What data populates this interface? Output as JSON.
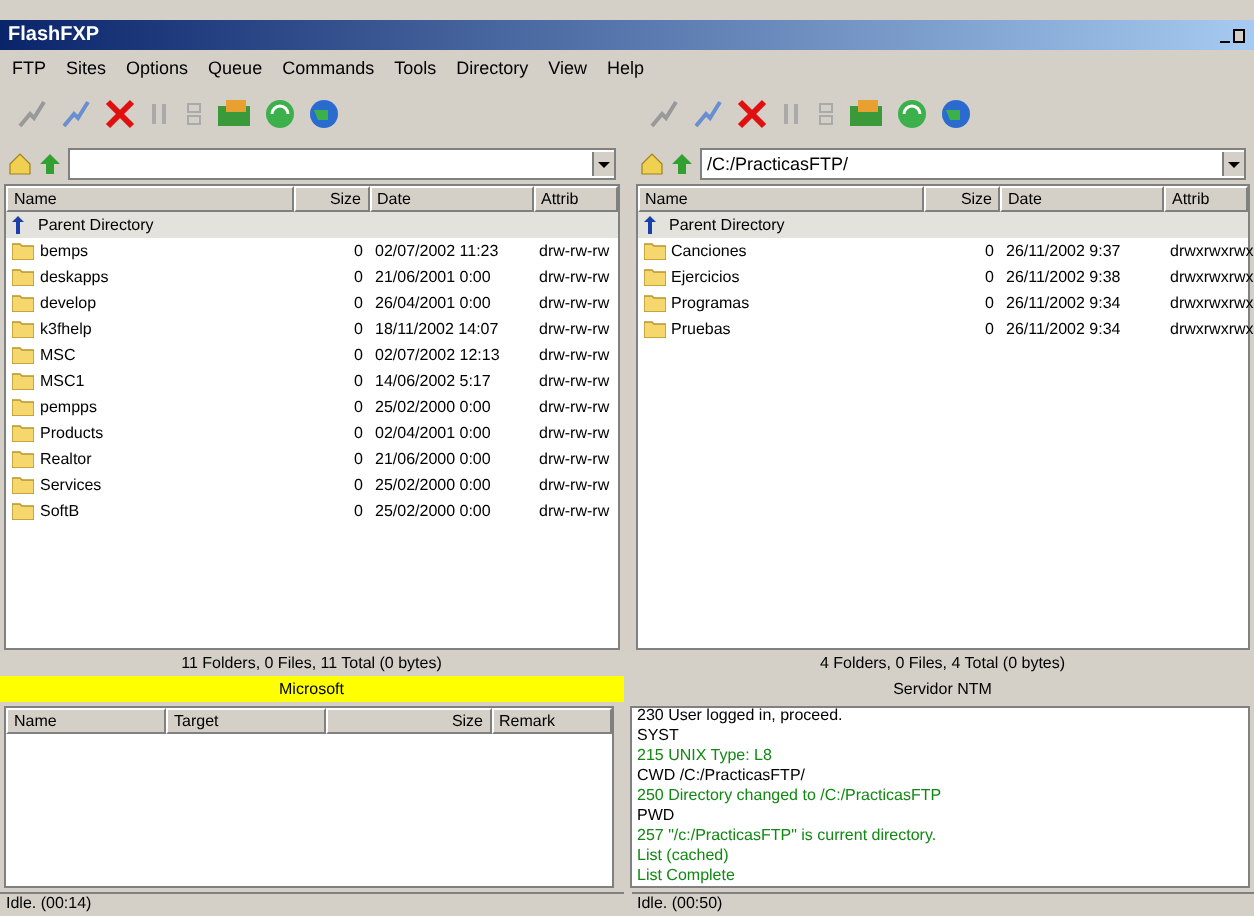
{
  "window": {
    "title": "FlashFXP"
  },
  "menu": [
    "FTP",
    "Sites",
    "Options",
    "Queue",
    "Commands",
    "Tools",
    "Directory",
    "View",
    "Help"
  ],
  "panes": [
    {
      "columns": [
        "Name",
        "Size",
        "Date",
        "Attrib"
      ],
      "parent": "Parent Directory",
      "rows": [
        {
          "name": "bemps",
          "size": "0",
          "date": "02/07/2002 11:23",
          "attrib": "drw-rw-rw"
        },
        {
          "name": "deskapps",
          "size": "0",
          "date": "21/06/2001 0:00",
          "attrib": "drw-rw-rw"
        },
        {
          "name": "develop",
          "size": "0",
          "date": "26/04/2001 0:00",
          "attrib": "drw-rw-rw"
        },
        {
          "name": "k3fhelp",
          "size": "0",
          "date": "18/11/2002 14:07",
          "attrib": "drw-rw-rw"
        },
        {
          "name": "MSC",
          "size": "0",
          "date": "02/07/2002 12:13",
          "attrib": "drw-rw-rw"
        },
        {
          "name": "MSC1",
          "size": "0",
          "date": "14/06/2002 5:17",
          "attrib": "drw-rw-rw"
        },
        {
          "name": "pempps",
          "size": "0",
          "date": "25/02/2000 0:00",
          "attrib": "drw-rw-rw"
        },
        {
          "name": "Products",
          "size": "0",
          "date": "02/04/2001 0:00",
          "attrib": "drw-rw-rw"
        },
        {
          "name": "Realtor",
          "size": "0",
          "date": "21/06/2000 0:00",
          "attrib": "drw-rw-rw"
        },
        {
          "name": "Services",
          "size": "0",
          "date": "25/02/2000 0:00",
          "attrib": "drw-rw-rw"
        },
        {
          "name": "SoftB",
          "size": "0",
          "date": "25/02/2000 0:00",
          "attrib": "drw-rw-rw"
        }
      ],
      "summary": "11 Folders, 0 Files, 11 Total (0 bytes)",
      "server": "Microsoft",
      "server_highlight": true
    },
    {
      "path": "/C:/PracticasFTP/",
      "columns": [
        "Name",
        "Size",
        "Date",
        "Attrib"
      ],
      "parent": "Parent Directory",
      "rows": [
        {
          "name": "Canciones",
          "size": "0",
          "date": "26/11/2002 9:37",
          "attrib": "drwxrwxrwx"
        },
        {
          "name": "Ejercicios",
          "size": "0",
          "date": "26/11/2002 9:38",
          "attrib": "drwxrwxrwx"
        },
        {
          "name": "Programas",
          "size": "0",
          "date": "26/11/2002 9:34",
          "attrib": "drwxrwxrwx"
        },
        {
          "name": "Pruebas",
          "size": "0",
          "date": "26/11/2002 9:34",
          "attrib": "drwxrwxrwx"
        }
      ],
      "summary": "4 Folders, 0 Files, 4 Total (0 bytes)",
      "server": "Servidor NTM",
      "server_highlight": false
    }
  ],
  "queue": {
    "columns": [
      "Name",
      "Target",
      "Size",
      "Remark"
    ]
  },
  "log": [
    {
      "kind": "command",
      "text": "230 User logged in, proceed."
    },
    {
      "kind": "command",
      "text": "SYST"
    },
    {
      "kind": "reply",
      "text": "215 UNIX Type: L8"
    },
    {
      "kind": "command",
      "text": "CWD /C:/PracticasFTP/"
    },
    {
      "kind": "reply",
      "text": "250 Directory changed to /C:/PracticasFTP"
    },
    {
      "kind": "command",
      "text": "PWD"
    },
    {
      "kind": "reply",
      "text": "257 \"/c:/PracticasFTP\" is current directory."
    },
    {
      "kind": "reply",
      "text": "List (cached)"
    },
    {
      "kind": "reply",
      "text": "List Complete"
    }
  ],
  "status": [
    "Idle. (00:14)",
    "Idle. (00:50)"
  ]
}
